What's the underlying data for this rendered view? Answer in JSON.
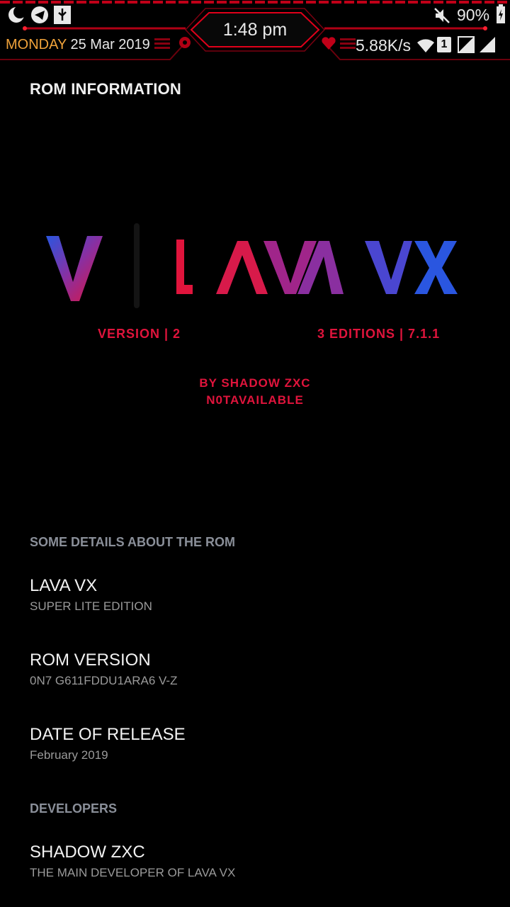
{
  "status_bar": {
    "day": "MONDAY",
    "date": "25 Mar 2019",
    "time": "1:48 pm",
    "battery": "90%",
    "net_speed": "5.88K/s",
    "sim_slot": "1",
    "accent_color": "#e0001a"
  },
  "page": {
    "title": "ROM INFORMATION"
  },
  "banner": {
    "logo_left": "V",
    "logo_main": "LAVA VX",
    "version_label": "VERSION | 2",
    "editions_label": "3 EDITIONS | 7.1.1",
    "by_line": "BY SHADOW ZXC",
    "by_line2": "N0TAVAILABLE",
    "colors": {
      "red": "#e0143c",
      "purple": "#8a2fa0",
      "blue": "#2a56e0"
    }
  },
  "details": {
    "header": "SOME DETAILS ABOUT THE ROM",
    "items": [
      {
        "title": "LAVA VX",
        "subtitle": "SUPER LITE EDITION"
      },
      {
        "title": "ROM VERSION",
        "subtitle": "0N7 G611FDDU1ARA6 V-Z"
      },
      {
        "title": "DATE OF RELEASE",
        "subtitle": "February 2019"
      }
    ]
  },
  "developers": {
    "header": "DEVELOPERS",
    "items": [
      {
        "title": "SHADOW ZXC",
        "subtitle": "THE MAIN DEVELOPER OF LAVA VX"
      }
    ]
  }
}
